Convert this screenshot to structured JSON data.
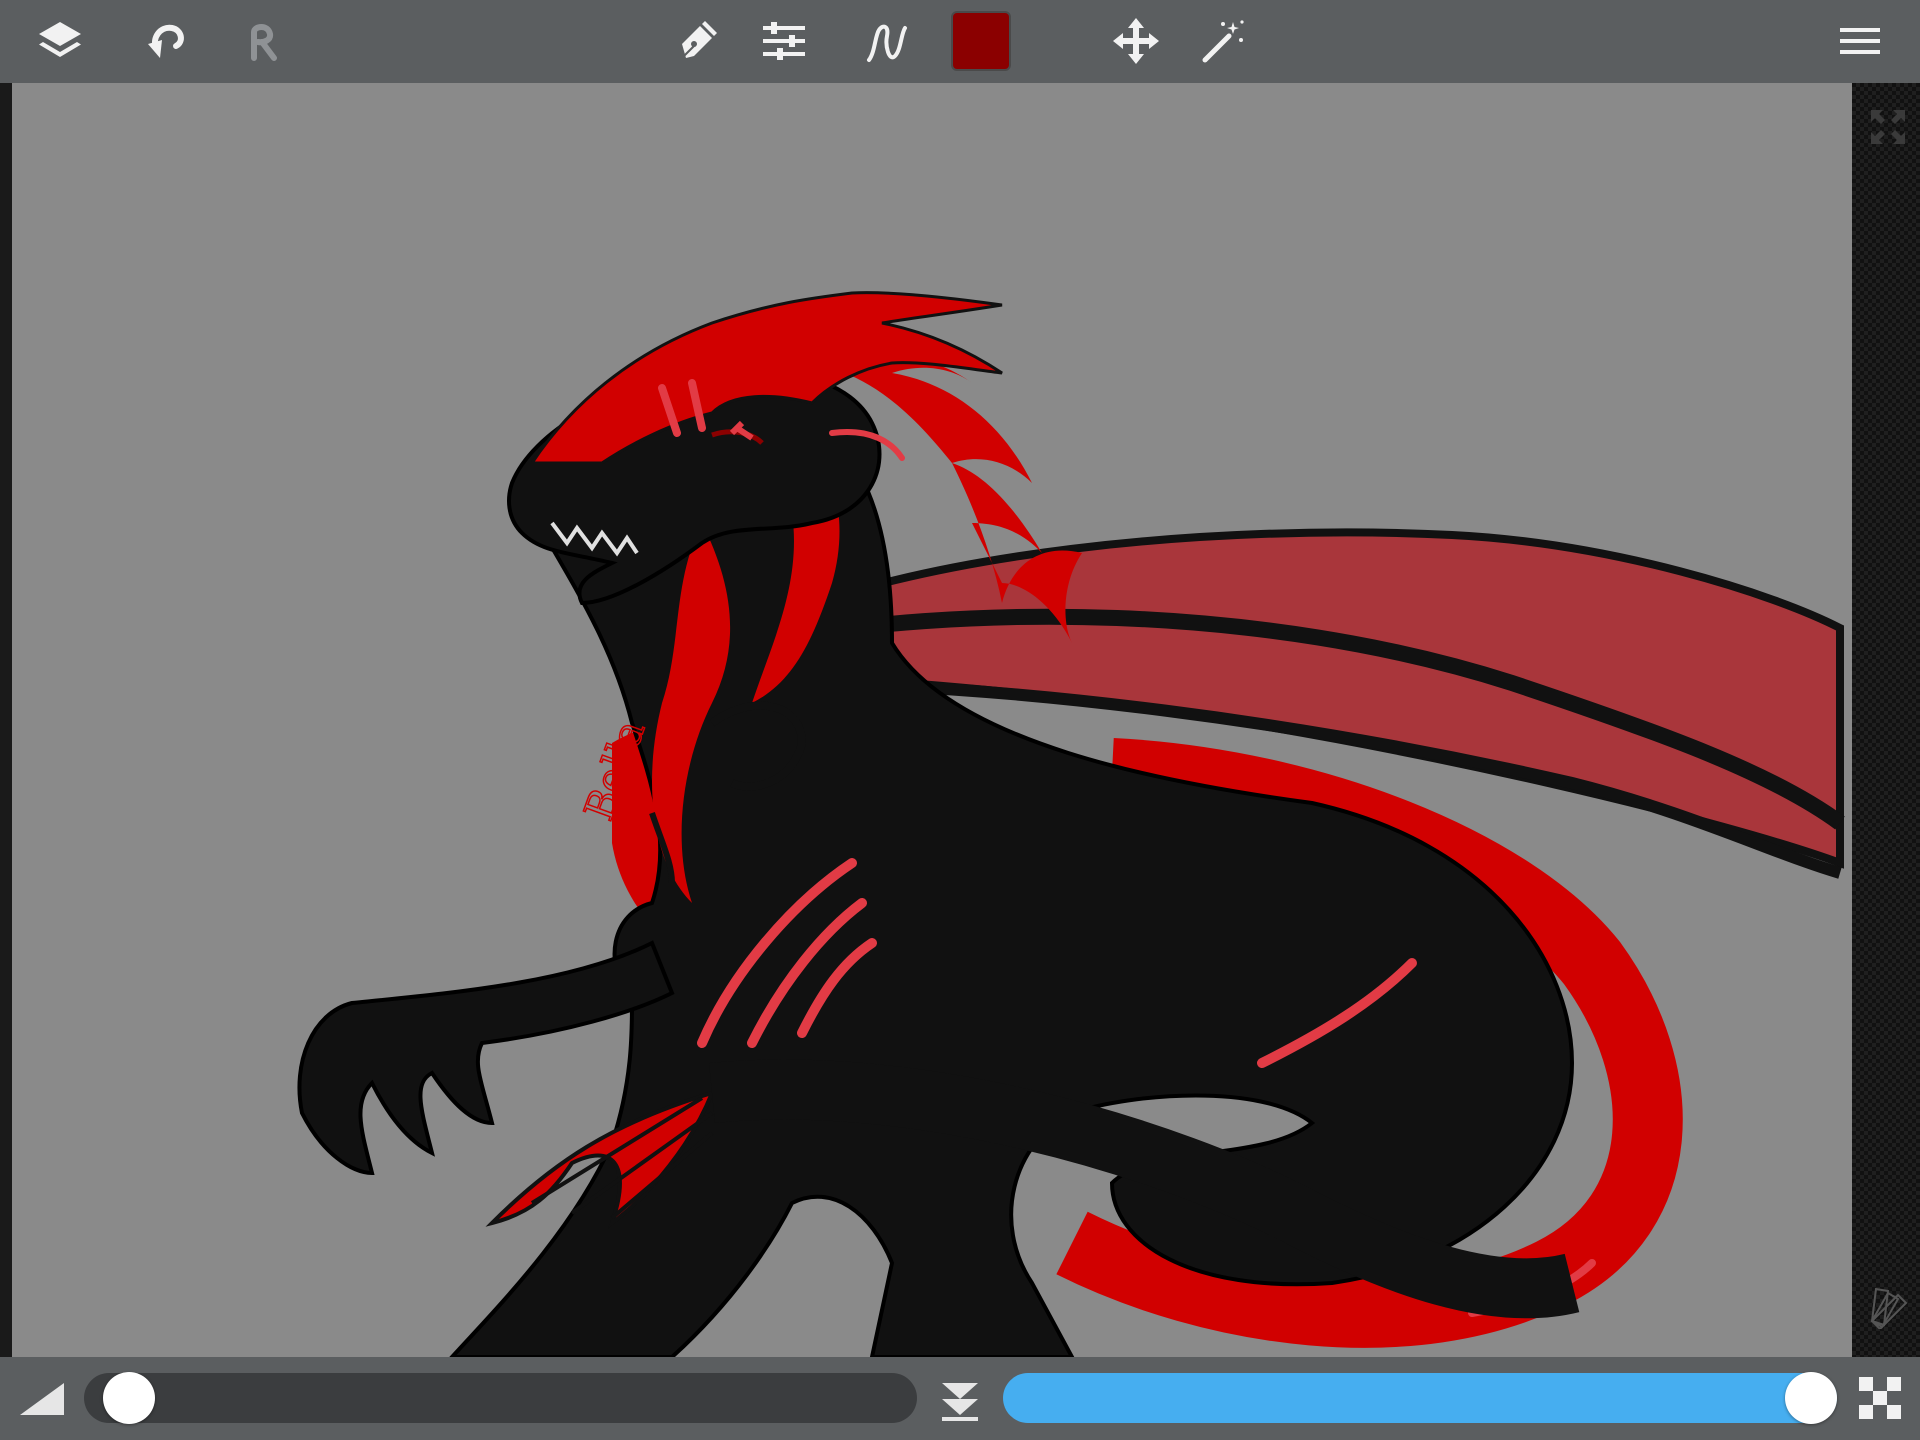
{
  "app": {
    "name": "paint-app"
  },
  "toolbar": {
    "left_icons": [
      "layers-icon",
      "undo-icon",
      "redo-icon"
    ],
    "center_icons": [
      "pen-tool-icon",
      "brush-settings-icon",
      "stroke-smoothing-icon",
      "transform-move-icon",
      "magic-wand-icon"
    ],
    "right_icons": [
      "menu-icon"
    ],
    "current_color": "#8b0000",
    "redo_enabled": false
  },
  "canvas": {
    "background_color": "#8a8a8a",
    "signature_text": "Bella",
    "palette_colors": [
      "#111111",
      "#d10000",
      "#8b0000",
      "#a9363b",
      "#e23b45"
    ]
  },
  "side_panel": {
    "icons": [
      "fullscreen-icon",
      "color-palette-icon"
    ]
  },
  "bottombar": {
    "brush_size": {
      "label_icon": "brush-size-icon",
      "value_fraction": 0.03
    },
    "merge_icon": "merge-down-icon",
    "opacity": {
      "value_fraction": 1.0
    },
    "transparency_icon": "checkerboard-icon",
    "accent_color": "#46aef0"
  }
}
